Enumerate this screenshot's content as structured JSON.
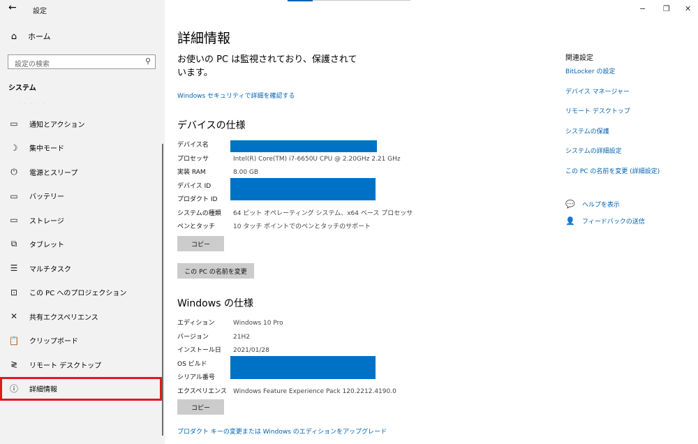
{
  "window": {
    "title": "設定",
    "back_icon": "←",
    "minimize_icon": "−",
    "restore_icon": "❐",
    "close_icon": "✕"
  },
  "sidebar": {
    "home_label": "ホーム",
    "home_icon": "⌂",
    "search_placeholder": "設定の検索",
    "search_icon": "⚲",
    "section_header": "システム",
    "faint_text": "· · · · ·",
    "items": [
      {
        "label": "通知とアクション",
        "icon": "▭"
      },
      {
        "label": "集中モード",
        "icon": "☽"
      },
      {
        "label": "電源とスリープ",
        "icon": "⏻"
      },
      {
        "label": "バッテリー",
        "icon": "▭"
      },
      {
        "label": "ストレージ",
        "icon": "▭"
      },
      {
        "label": "タブレット",
        "icon": "⧉"
      },
      {
        "label": "マルチタスク",
        "icon": "☰"
      },
      {
        "label": "この PC へのプロジェクション",
        "icon": "⊡"
      },
      {
        "label": "共有エクスペリエンス",
        "icon": "✕"
      },
      {
        "label": "クリップボード",
        "icon": "📋"
      },
      {
        "label": "リモート デスクトップ",
        "icon": "≷"
      },
      {
        "label": "詳細情報",
        "icon": "ⓘ",
        "selected": true
      }
    ]
  },
  "main": {
    "title": "詳細情報",
    "protection_text": "お使いの PC は監視されており、保護されています。",
    "security_link": "Windows セキュリティで詳細を確認する",
    "device_specs": {
      "heading": "デバイスの仕様",
      "rows": [
        {
          "label": "デバイス名",
          "value": ""
        },
        {
          "label": "プロセッサ",
          "value": "Intel(R) Core(TM) i7-6650U CPU @ 2.20GHz   2.21 GHz"
        },
        {
          "label": "実装 RAM",
          "value": "8.00 GB"
        },
        {
          "label": "デバイス ID",
          "value": ""
        },
        {
          "label": "プロダクト ID",
          "value": ""
        },
        {
          "label": "システムの種類",
          "value": "64 ビット オペレーティング システム、x64 ベース プロセッサ"
        },
        {
          "label": "ペンとタッチ",
          "value": "10 タッチ ポイントでのペンとタッチのサポート"
        }
      ],
      "copy_button": "コピー",
      "rename_button": "この PC の名前を変更"
    },
    "windows_specs": {
      "heading": "Windows の仕様",
      "rows": [
        {
          "label": "エディション",
          "value": "Windows 10 Pro"
        },
        {
          "label": "バージョン",
          "value": "21H2"
        },
        {
          "label": "インストール日",
          "value": "2021/01/28"
        },
        {
          "label": "OS ビルド",
          "value": ""
        },
        {
          "label": "シリアル番号",
          "value": ""
        },
        {
          "label": "エクスペリエンス",
          "value": "Windows Feature Experience Pack 120.2212.4190.0"
        }
      ],
      "copy_button": "コピー"
    },
    "upgrade_link": "プロダクト キーの変更または Windows のエディションをアップグレード"
  },
  "related": {
    "heading": "関連設定",
    "links": [
      "BitLocker の設定",
      "デバイス マネージャー",
      "リモート デスクトップ",
      "システムの保護",
      "システムの詳細設定",
      "この PC の名前を変更 (詳細設定)"
    ],
    "help_label": "ヘルプを表示",
    "help_icon": "💬",
    "feedback_label": "フィードバックの送信",
    "feedback_icon": "👤"
  },
  "colors": {
    "accent": "#0063b1",
    "redaction": "#0072c6",
    "selection_outline": "#e0191f",
    "sidebar_bg": "#f2f2f2"
  }
}
